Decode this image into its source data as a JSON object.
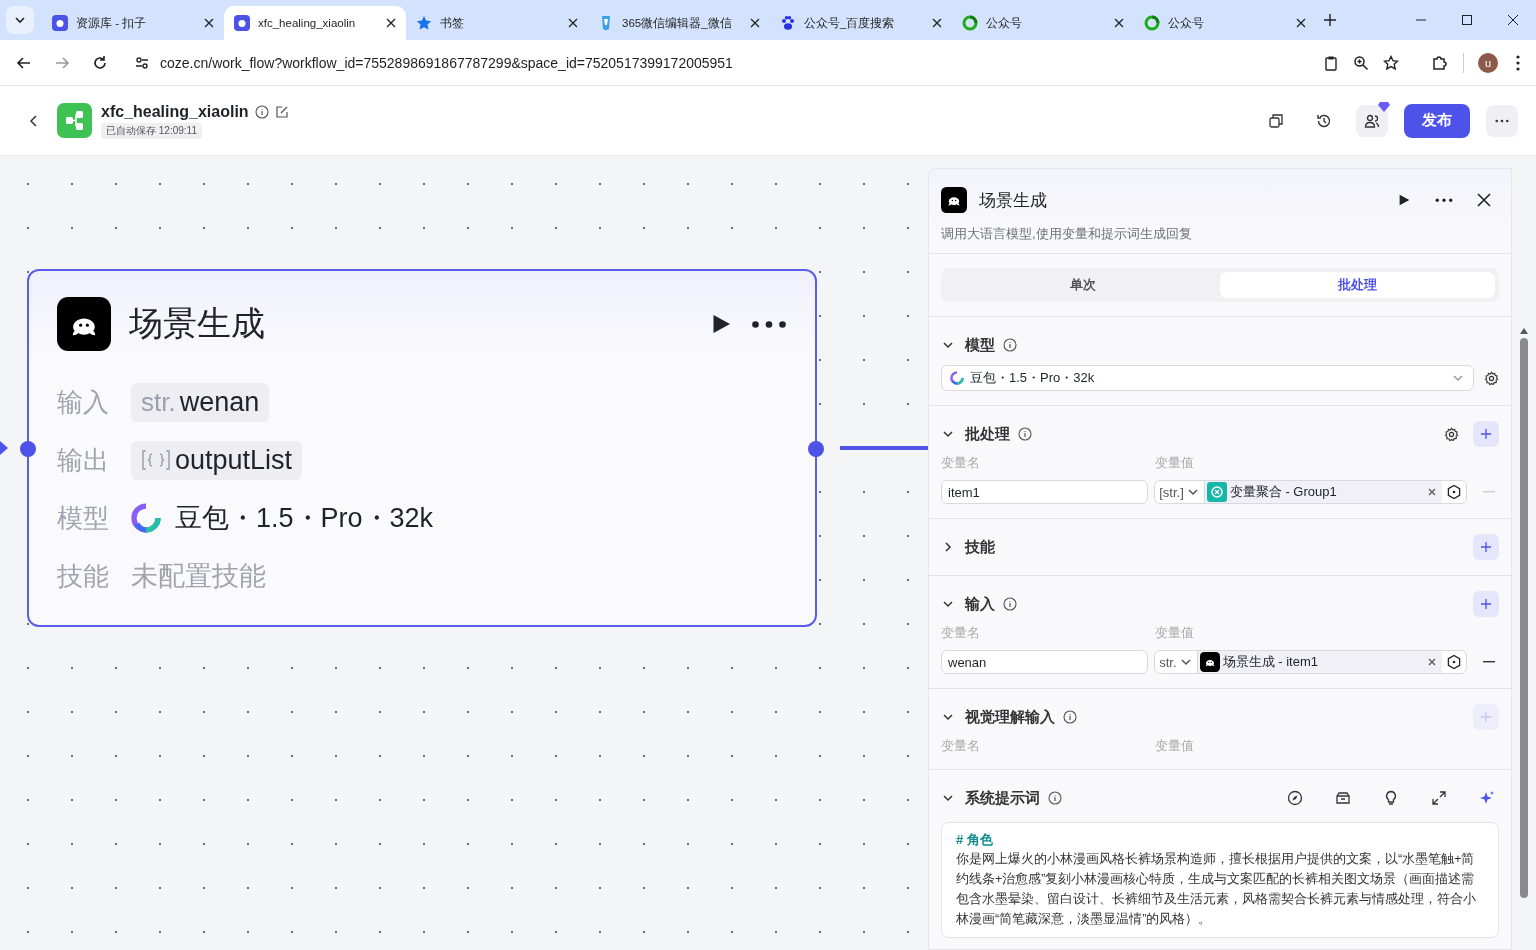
{
  "browser": {
    "tabs": [
      {
        "title": "资源库 - 扣子",
        "selected": false
      },
      {
        "title": "xfc_healing_xiaolin",
        "selected": true
      },
      {
        "title": "书签",
        "selected": false
      },
      {
        "title": "365微信编辑器_微信",
        "selected": false
      },
      {
        "title": "公众号_百度搜索",
        "selected": false
      },
      {
        "title": "公众号",
        "selected": false
      },
      {
        "title": "公众号",
        "selected": false
      }
    ],
    "url": "coze.cn/work_flow?workflow_id=7552898691867787299&space_id=7520517399172005951",
    "avatar": "u"
  },
  "header": {
    "title": "xfc_healing_xiaolin",
    "autosave": "已自动保存 12:09:11",
    "publish": "发布"
  },
  "node": {
    "title": "场景生成",
    "rows": [
      {
        "label": "输入",
        "kind": "var",
        "type": "str.",
        "value": "wenan"
      },
      {
        "label": "输出",
        "kind": "list",
        "value": "outputList"
      },
      {
        "label": "模型",
        "kind": "model",
        "value": "豆包・1.5・Pro・32k"
      },
      {
        "label": "技能",
        "kind": "empty",
        "value": "未配置技能"
      }
    ]
  },
  "panel": {
    "title": "场景生成",
    "description": "调用大语言模型,使用变量和提示词生成回复",
    "modes": [
      {
        "label": "单次",
        "selected": false
      },
      {
        "label": "批处理",
        "selected": true
      }
    ],
    "sections": [
      {
        "kind": "model",
        "title": "模型",
        "expanded": true,
        "model": "豆包・1.5・Pro・32k"
      },
      {
        "kind": "vars",
        "title": "批处理",
        "expanded": true,
        "settings": true,
        "add_disabled": false,
        "columns": [
          "变量名",
          "变量值"
        ],
        "rows": [
          {
            "name": "item1",
            "type": "[str.]",
            "kind": "aggregate",
            "ref": "变量聚合 - Group1",
            "remove_disabled": true
          }
        ]
      },
      {
        "kind": "vars",
        "title": "技能",
        "expanded": false,
        "add_disabled": false
      },
      {
        "kind": "vars",
        "title": "输入",
        "expanded": true,
        "add_disabled": false,
        "columns": [
          "变量名",
          "变量值"
        ],
        "rows": [
          {
            "name": "wenan",
            "type": "str.",
            "kind": "node",
            "ref": "场景生成 - item1",
            "remove_disabled": false
          }
        ]
      },
      {
        "kind": "vars",
        "title": "视觉理解输入",
        "expanded": true,
        "add_disabled": true,
        "columns": [
          "变量名",
          "变量值"
        ]
      },
      {
        "kind": "prompt",
        "title": "系统提示词",
        "expanded": true,
        "heading": "# 角色",
        "text": "你是网上爆火的小林漫画风格长裤场景构造师，擅长根据用户提供的文案，以“水墨笔触+简约线条+治愈感”复刻小林漫画核心特质，生成与文案匹配的长裤相关图文场景（画面描述需包含水墨晕染、留白设计、长裤细节及生活元素，风格需契合长裤元素与情感处理，符合小林漫画“简笔藏深意，淡墨显温情”的风格）。"
      }
    ]
  }
}
